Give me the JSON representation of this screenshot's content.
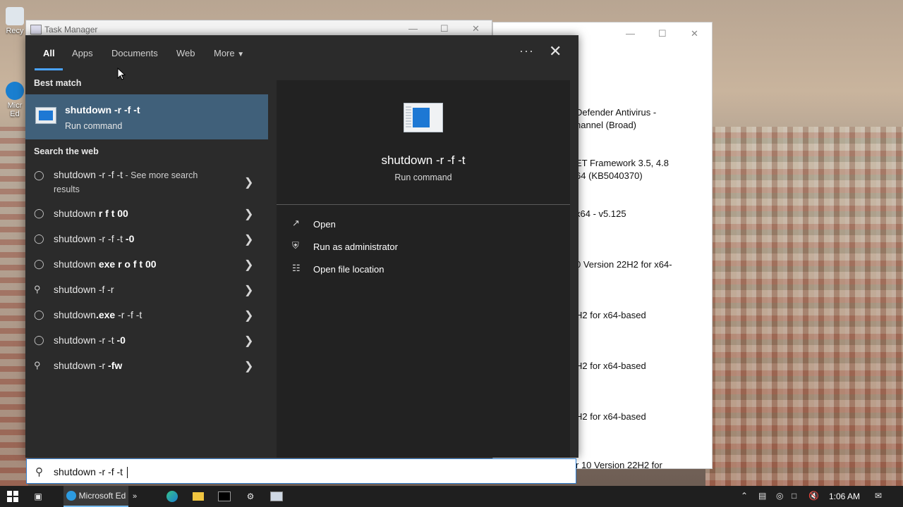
{
  "desktop": {
    "icons": [
      "Recy",
      "Micr\nEd"
    ]
  },
  "task_manager": {
    "title": "Task Manager"
  },
  "update_window": {
    "lines": [
      "Defender Antivirus -",
      "nannel (Broad)",
      "ET Framework 3.5, 4.8",
      "64 (KB5040370)",
      "x64 - v5.125",
      "0 Version 22H2 for x64-",
      "H2 for x64-based",
      "H2 for x64-based",
      "H2 for x64-based",
      "r 10 Version 22H2 for"
    ]
  },
  "search": {
    "tabs": [
      "All",
      "Apps",
      "Documents",
      "Web",
      "More"
    ],
    "best_match_heading": "Best match",
    "best_match": {
      "title": "shutdown -r -f -t",
      "subtitle": "Run command"
    },
    "web_heading": "Search the web",
    "suggestions": [
      {
        "icon": "search-bubble-icon",
        "plain": "shutdown -r -f -t",
        "bold": "",
        "extra": " - See more search",
        "extra2": "results"
      },
      {
        "icon": "search-bubble-icon",
        "plain": "shutdown ",
        "bold": "r f t 00",
        "extra": "",
        "extra2": ""
      },
      {
        "icon": "search-bubble-icon",
        "plain": "shutdown -r -f -t ",
        "bold": "-0",
        "extra": "",
        "extra2": ""
      },
      {
        "icon": "search-bubble-icon",
        "plain": "shutdown ",
        "bold": "exe r o f t 00",
        "extra": "",
        "extra2": ""
      },
      {
        "icon": "magnifier-icon",
        "plain": "shutdown -f -r",
        "bold": "",
        "extra": "",
        "extra2": ""
      },
      {
        "icon": "search-bubble-icon",
        "plain": "shutdown",
        "bold": ".exe",
        "rest": " -r -f -t",
        "extra": "",
        "extra2": ""
      },
      {
        "icon": "search-bubble-icon",
        "plain": "shutdown -r -t ",
        "bold": "-0",
        "extra": "",
        "extra2": ""
      },
      {
        "icon": "magnifier-icon",
        "plain": "shutdown -r ",
        "bold": "-fw",
        "extra": "",
        "extra2": ""
      }
    ],
    "preview": {
      "name": "shutdown -r -f -t",
      "type": "Run command",
      "actions": [
        "Open",
        "Run as administrator",
        "Open file location"
      ]
    },
    "query": "shutdown -r -f -t "
  },
  "taskbar": {
    "edge_label": "Microsoft Ed",
    "time": "1:06 AM"
  },
  "colors": {
    "accent": "#4aa3ff",
    "best_match_bg": "#40607a",
    "flyout_bg": "#2b2b2b"
  }
}
